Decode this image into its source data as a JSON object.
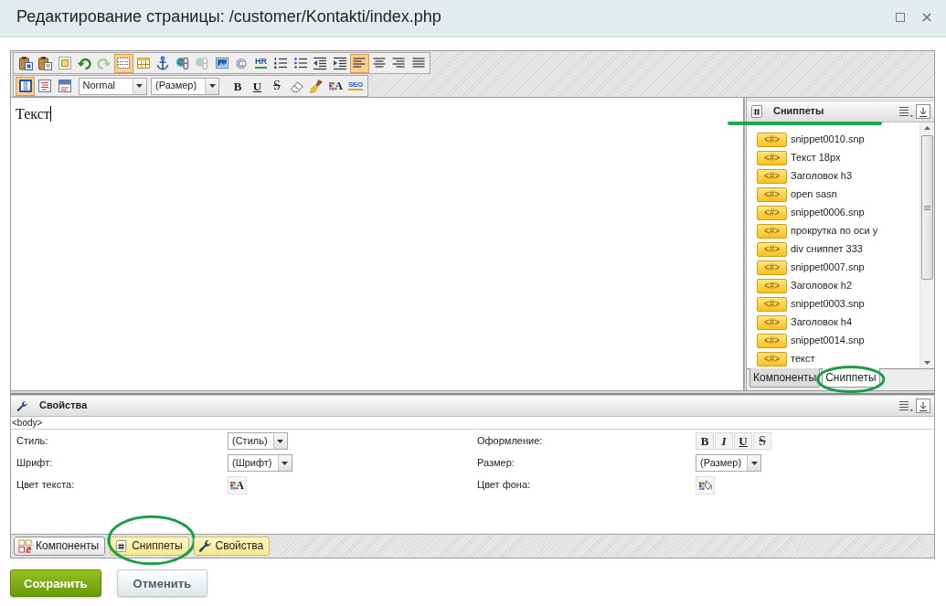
{
  "window": {
    "title": "Редактирование страницы: /customer/Kontakti/index.php",
    "controls": [
      {
        "kind": "maximize"
      },
      {
        "kind": "close"
      }
    ]
  },
  "toolbar": {
    "row_1": [
      {
        "kind": "wordpaste",
        "active": false,
        "disabled": false
      },
      {
        "kind": "textpaste",
        "active": false,
        "disabled": false
      },
      {
        "kind": "selectall",
        "active": false,
        "disabled": false
      },
      {
        "kind": "undo",
        "active": false,
        "disabled": false
      },
      {
        "kind": "redo",
        "active": false,
        "disabled": true
      },
      {
        "kind": "borders",
        "active": true,
        "disabled": false
      },
      {
        "kind": "table",
        "active": false,
        "disabled": false
      },
      {
        "kind": "anchor",
        "active": false,
        "disabled": false
      },
      {
        "kind": "link",
        "active": false,
        "disabled": false
      },
      {
        "kind": "unlink",
        "active": false,
        "disabled": true
      },
      {
        "kind": "image",
        "active": false,
        "disabled": false
      },
      {
        "kind": "copyright",
        "label": "©",
        "active": false,
        "disabled": false
      },
      {
        "kind": "hr",
        "label": "HR",
        "active": false,
        "disabled": false
      },
      {
        "kind": "olist",
        "active": false,
        "disabled": false
      },
      {
        "kind": "ulist",
        "active": false,
        "disabled": false
      },
      {
        "kind": "outdent",
        "active": false,
        "disabled": false
      },
      {
        "kind": "indent",
        "active": false,
        "disabled": false
      },
      {
        "kind": "left",
        "active": true,
        "disabled": false
      },
      {
        "kind": "center",
        "active": false,
        "disabled": false
      },
      {
        "kind": "right",
        "active": false,
        "disabled": false
      },
      {
        "kind": "justify",
        "active": false,
        "disabled": false
      }
    ],
    "row_2": [
      {
        "kind": "wysiwyg",
        "active": true
      },
      {
        "kind": "code",
        "active": false
      },
      {
        "kind": "split",
        "active": false
      },
      {
        "kind": "select",
        "value": "Normal"
      },
      {
        "kind": "select",
        "value": "(Размер)"
      },
      {
        "kind": "bold",
        "label": "B",
        "active": false
      },
      {
        "kind": "underline",
        "label": "U",
        "active": false
      },
      {
        "kind": "strike",
        "label": "S",
        "active": false
      },
      {
        "kind": "eraser",
        "active": false
      },
      {
        "kind": "brush",
        "active": false
      },
      {
        "kind": "textcolor",
        "label": "A",
        "active": false
      },
      {
        "kind": "seo",
        "label": "SEO",
        "active": false
      }
    ]
  },
  "editor": {
    "text": "Текст",
    "cursor": true
  },
  "snippets_panel": {
    "title": "Сниппеты",
    "underlined": true,
    "items": [
      {
        "badge": "<#>",
        "name": "snippet0010.snp"
      },
      {
        "badge": "<#>",
        "name": "Текст 18px"
      },
      {
        "badge": "<#>",
        "name": "Заголовок h3"
      },
      {
        "badge": "<#>",
        "name": "open sasn"
      },
      {
        "badge": "<#>",
        "name": "snippet0006.snp"
      },
      {
        "badge": "<#>",
        "name": "прокрутка по оси у"
      },
      {
        "badge": "<#>",
        "name": "div сниппет 333"
      },
      {
        "badge": "<#>",
        "name": "snippet0007.snp"
      },
      {
        "badge": "<#>",
        "name": "Заголовок h2"
      },
      {
        "badge": "<#>",
        "name": "snippet0003.snp"
      },
      {
        "badge": "<#>",
        "name": "Заголовок h4"
      },
      {
        "badge": "<#>",
        "name": "snippet0014.snp"
      },
      {
        "badge": "<#>",
        "name": "текст"
      }
    ],
    "tabs": [
      {
        "label": "Компоненты",
        "selected": false,
        "circled": false
      },
      {
        "label": "Сниппеты",
        "selected": true,
        "circled": true
      }
    ]
  },
  "properties_panel": {
    "title": "Свойства",
    "breadcrumb": "<body>",
    "fields": [
      {
        "label": "Стиль:",
        "kind": "select",
        "value": "(Стиль)"
      },
      {
        "label": "Оформление:",
        "kind": "format",
        "buttons": [
          {
            "kind": "bold",
            "label": "B"
          },
          {
            "kind": "italic",
            "label": "I"
          },
          {
            "kind": "underline",
            "label": "U"
          },
          {
            "kind": "strike",
            "label": "S"
          }
        ]
      },
      {
        "label": "Шрифт:",
        "kind": "select",
        "value": "(Шрифт)"
      },
      {
        "label": "Размер:",
        "kind": "select",
        "value": "(Размер)"
      },
      {
        "label": "Цвет текста:",
        "kind": "textcolor",
        "icon_text": "A"
      },
      {
        "label": "Цвет фона:",
        "kind": "bgcolor"
      }
    ]
  },
  "bottom_tabs": [
    {
      "kind": "components",
      "label": "Компоненты",
      "selected": false,
      "circled": false
    },
    {
      "kind": "snippets",
      "label": "Сниппеты",
      "selected": true,
      "circled": true
    },
    {
      "kind": "properties",
      "label": "Свойства",
      "selected": true,
      "circled": false
    }
  ],
  "buttons": [
    {
      "kind": "primary",
      "label": "Сохранить"
    },
    {
      "kind": "secondary",
      "label": "Отменить"
    }
  ]
}
